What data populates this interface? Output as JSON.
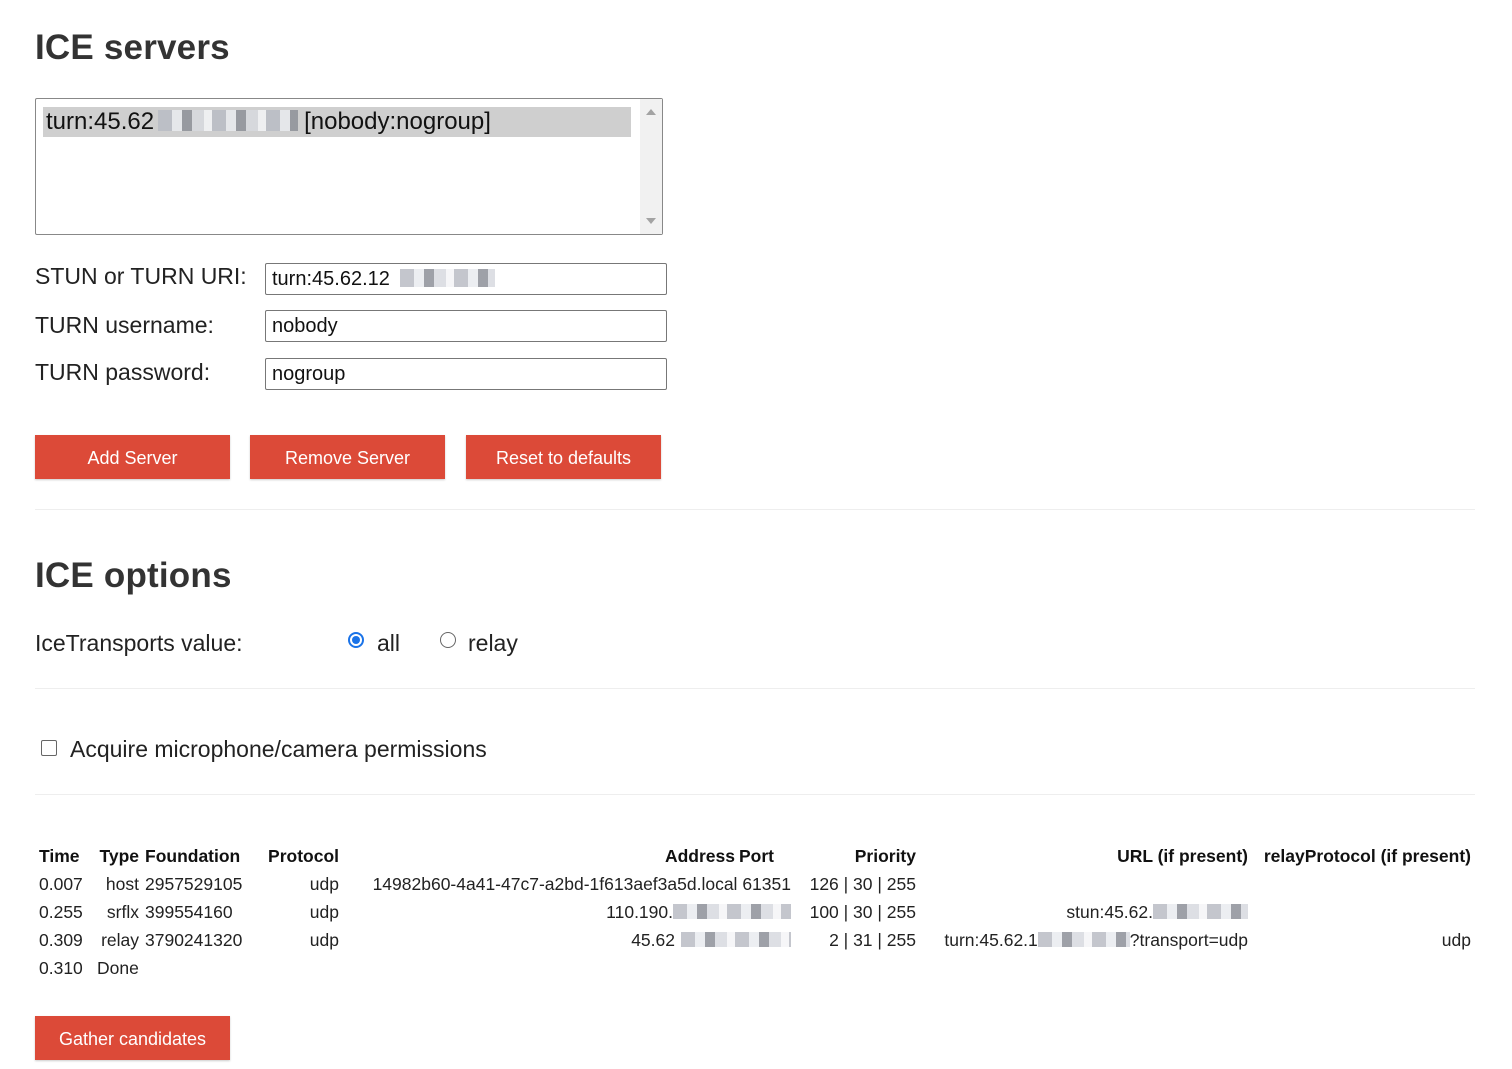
{
  "servers_section": {
    "title": "ICE servers",
    "list": [
      {
        "prefix": "turn:45.62",
        "suffix": "[nobody:nogroup]"
      }
    ],
    "uri_label": "STUN or TURN URI:",
    "uri_value": "turn:45.62.12",
    "username_label": "TURN username:",
    "username_value": "nobody",
    "password_label": "TURN password:",
    "password_value": "nogroup",
    "buttons": {
      "add": "Add Server",
      "remove": "Remove Server",
      "reset": "Reset to defaults"
    }
  },
  "options_section": {
    "title": "ICE options",
    "transports_label": "IceTransports value:",
    "radio_all": "all",
    "radio_relay": "relay",
    "selected": "all",
    "permissions_label": "Acquire microphone/camera permissions",
    "permissions_checked": false
  },
  "table": {
    "headers": [
      "Time",
      "Type",
      "Foundation",
      "Protocol",
      "Address",
      "Port",
      "Priority",
      "URL (if present)",
      "relayProtocol (if present)"
    ],
    "rows": [
      [
        "0.007",
        "host",
        "2957529105",
        "udp",
        "14982b60-4a41-47c7-a2bd-1f613aef3a5d.local",
        "61351",
        "126 | 30 | 255",
        "",
        ""
      ],
      [
        "0.255",
        "srflx",
        "399554160",
        "udp",
        "110.190.",
        "",
        "100 | 30 | 255",
        "stun:45.62.",
        ""
      ],
      [
        "0.309",
        "relay",
        "3790241320",
        "udp",
        "45.62",
        "",
        "2 | 31 | 255",
        "turn:45.62.1",
        "udp"
      ]
    ],
    "url_suffix_row3": "?transport=udp",
    "done_time": "0.310",
    "done_label": "Done"
  },
  "gather_button": "Gather candidates",
  "colors": {
    "accent": "#dc4a38",
    "radio": "#1a73e8"
  }
}
